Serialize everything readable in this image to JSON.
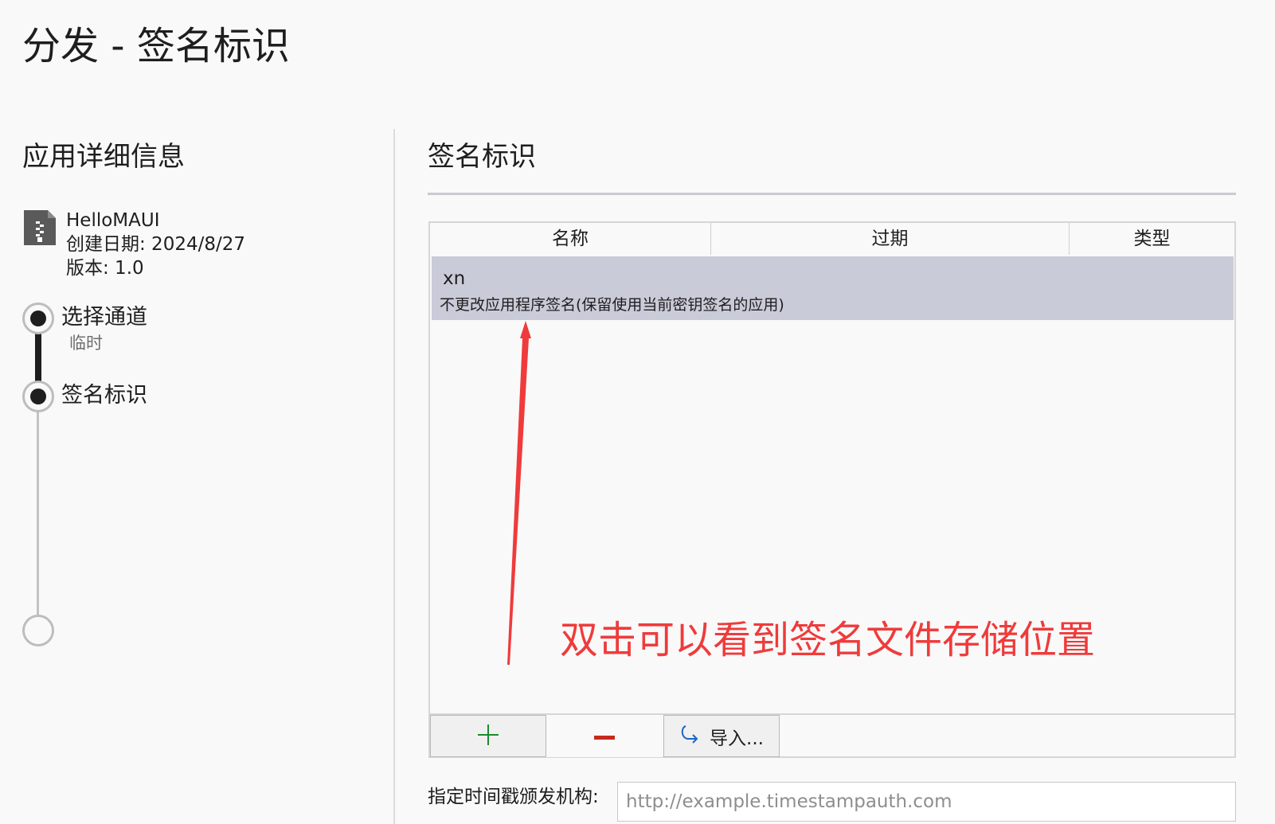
{
  "page": {
    "title": "分发 - 签名标识"
  },
  "sidebar": {
    "heading": "应用详细信息",
    "app": {
      "icon": "file-zip-icon",
      "name": "HelloMAUI",
      "created": "创建日期: 2024/8/27",
      "version": "版本: 1.0"
    },
    "steps": [
      {
        "label": "选择通道",
        "sub": "临时",
        "state": "done"
      },
      {
        "label": "签名标识",
        "sub": "",
        "state": "current"
      },
      {
        "label": "",
        "sub": "",
        "state": "pending"
      }
    ]
  },
  "main": {
    "heading": "签名标识",
    "table": {
      "columns": [
        "名称",
        "过期",
        "类型"
      ],
      "rows": [
        {
          "title": "xn",
          "description": "不更改应用程序签名(保留使用当前密钥签名的应用)",
          "selected": true
        }
      ]
    },
    "toolbar": {
      "add_icon": "plus-icon",
      "remove_icon": "minus-icon",
      "import_icon": "import-arrow-icon",
      "import_label": "导入..."
    },
    "timestamp": {
      "label": "指定时间戳颁发机构:",
      "placeholder": "http://example.timestampauth.com",
      "value": ""
    }
  },
  "annotation": {
    "text": "双击可以看到签名文件存储位置",
    "color": "#ef3b3b"
  },
  "colors": {
    "background": "#f9f9f9",
    "selected_row": "#cacbd8",
    "add_green": "#1a8a2e",
    "remove_red": "#c42b1c",
    "import_blue": "#1e64c8"
  }
}
